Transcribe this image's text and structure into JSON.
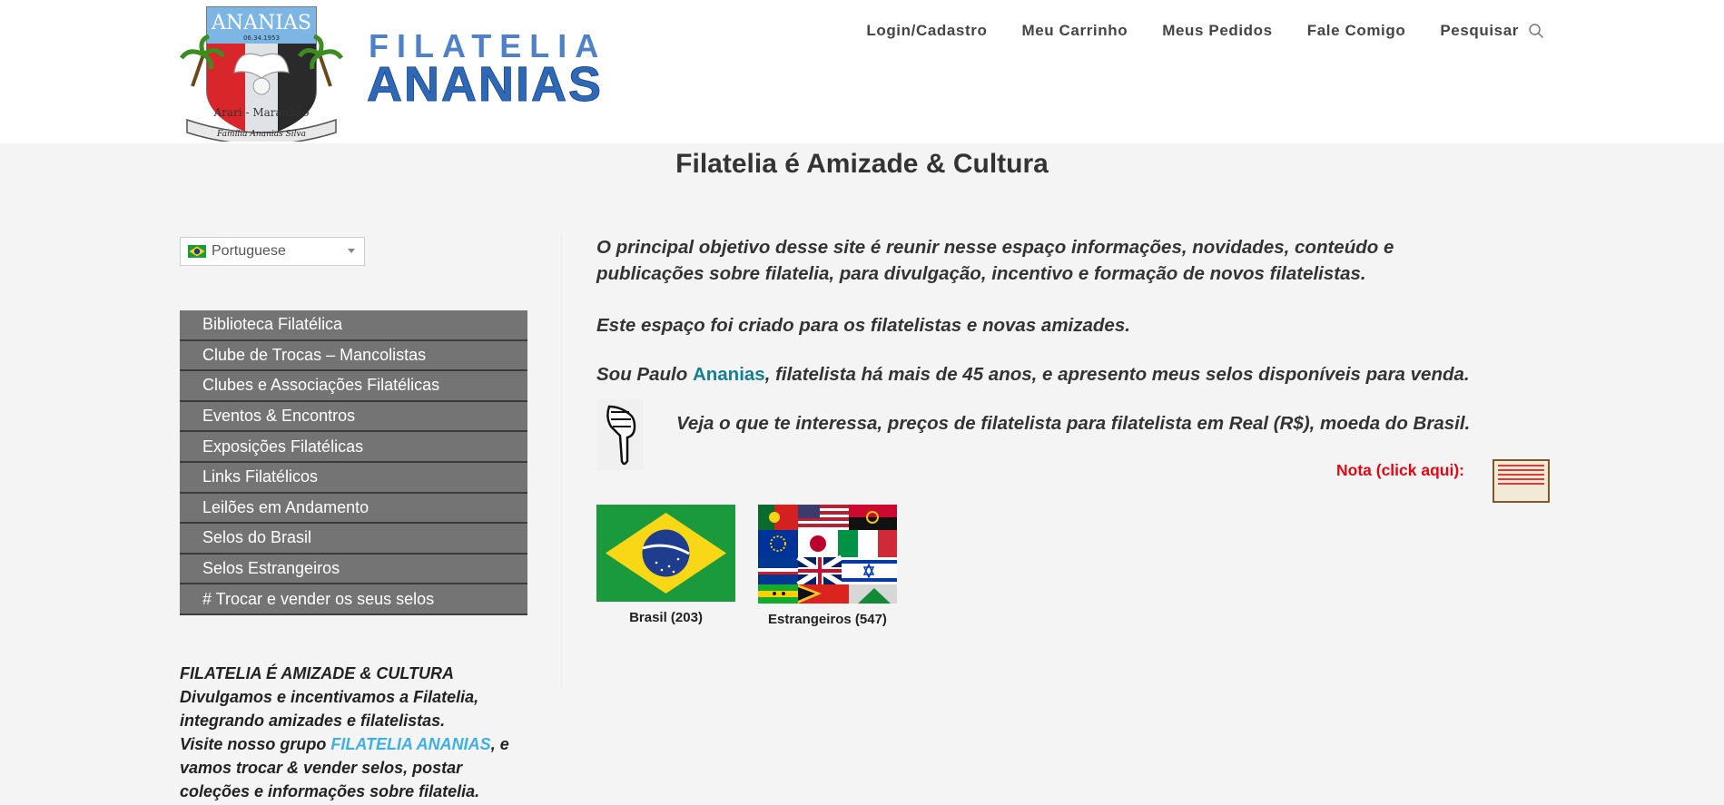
{
  "header": {
    "logo": {
      "emblem_text_top": "ANANIAS",
      "emblem_text_date": "06.34.1953",
      "emblem_text_bottom": "Arari - Maranhão",
      "emblem_banner": "Família Ananias Silva",
      "brand_line1": "FILATELIA",
      "brand_line2": "ANANIAS"
    },
    "nav": [
      {
        "label": "Login/Cadastro"
      },
      {
        "label": "Meu Carrinho"
      },
      {
        "label": "Meus Pedidos"
      },
      {
        "label": "Fale Comigo"
      },
      {
        "label": "Pesquisar",
        "icon": "search-icon"
      }
    ]
  },
  "page_title": "Filatelia é Amizade & Cultura",
  "sidebar": {
    "language": {
      "selected": "Portuguese",
      "icon": "brazil-flag-icon"
    },
    "menu": [
      {
        "label": "Biblioteca Filatélica"
      },
      {
        "label": "Clube de Trocas – Mancolistas"
      },
      {
        "label": "Clubes e Associações Filatélicas"
      },
      {
        "label": "Eventos & Encontros"
      },
      {
        "label": "Exposições Filatélicas"
      },
      {
        "label": "Links Filatélicos"
      },
      {
        "label": "Leilões em Andamento"
      },
      {
        "label": "Selos do Brasil"
      },
      {
        "label": "Selos Estrangeiros"
      },
      {
        "label": "# Trocar e vender os seus selos"
      }
    ],
    "about": {
      "line1": "FILATELIA É AMIZADE & CULTURA",
      "line2": "Divulgamos e incentivamos a Filatelia,",
      "line3": "integrando amizades e filatelistas.",
      "line4_pre": "Visite nosso grupo ",
      "line4_link": "FILATELIA ANANIAS",
      "line4_post": ", e",
      "line5": "vamos trocar & vender selos, postar",
      "line6": "coleções e informações sobre filatelia."
    }
  },
  "main": {
    "p1": "O principal objetivo desse site é reunir nesse espaço informações, novidades, conteúdo e publicações  sobre filatelia, para divulgação,  incentivo e  formação de novos filatelistas.",
    "p2": "Este espaço foi criado para os filatelistas e novas amizades.",
    "p3_pre": "Sou Paulo ",
    "p3_link": "Ananias",
    "p3_post": ",  filatelista há mais de 45 anos, e apresento meus selos disponíveis para venda.",
    "p4": "Veja o que te interessa,  preços de filatelista para filatelista em Real (R$), moeda do Brasil.",
    "hand_icon": "pointing-hand-icon",
    "nota_label": "Nota (click aqui):",
    "cards": [
      {
        "caption": "Brasil (203)",
        "icon": "brazil-flag-image"
      },
      {
        "caption": "Estrangeiros (547)",
        "icon": "world-flags-collage-image"
      }
    ]
  },
  "colors": {
    "menu_bg": "#747474",
    "link_teal": "#137f91",
    "link_blue": "#3fb0e3",
    "nota_red": "#e30613",
    "brand_blue": "#2f69b6"
  }
}
